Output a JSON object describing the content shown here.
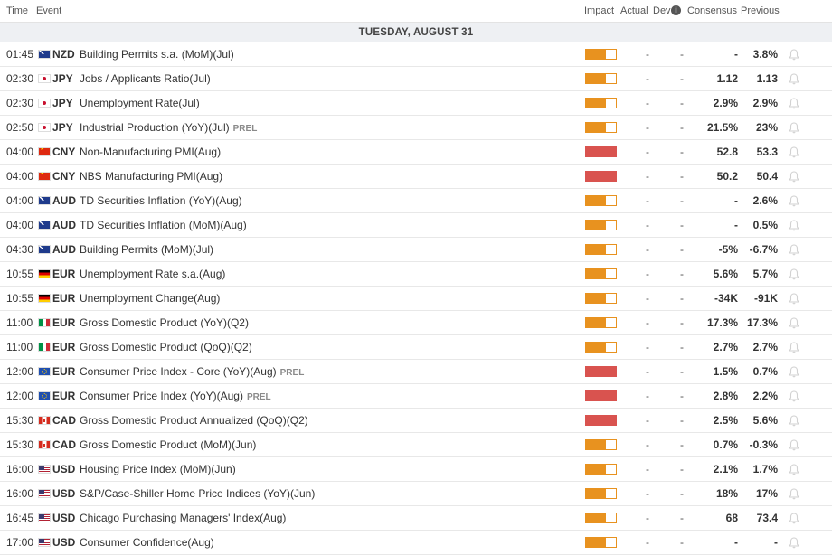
{
  "header": {
    "time": "Time",
    "event": "Event",
    "impact": "Impact",
    "actual": "Actual",
    "dev": "Dev",
    "consensus": "Consensus",
    "previous": "Previous"
  },
  "day_label": "TUESDAY, AUGUST 31",
  "rows": [
    {
      "time": "01:45",
      "currency": "NZD",
      "flag": "nz-flag-icon",
      "event": "Building Permits s.a. (MoM)(Jul)",
      "tag": "",
      "impact": "medium",
      "actual": "-",
      "dev": "-",
      "consensus": "-",
      "previous": "3.8%"
    },
    {
      "time": "02:30",
      "currency": "JPY",
      "flag": "jp-flag-icon",
      "event": "Jobs / Applicants Ratio(Jul)",
      "tag": "",
      "impact": "medium",
      "actual": "-",
      "dev": "-",
      "consensus": "1.12",
      "previous": "1.13"
    },
    {
      "time": "02:30",
      "currency": "JPY",
      "flag": "jp-flag-icon",
      "event": "Unemployment Rate(Jul)",
      "tag": "",
      "impact": "medium",
      "actual": "-",
      "dev": "-",
      "consensus": "2.9%",
      "previous": "2.9%"
    },
    {
      "time": "02:50",
      "currency": "JPY",
      "flag": "jp-flag-icon",
      "event": "Industrial Production (YoY)(Jul)",
      "tag": "PREL",
      "impact": "medium",
      "actual": "-",
      "dev": "-",
      "consensus": "21.5%",
      "previous": "23%"
    },
    {
      "time": "04:00",
      "currency": "CNY",
      "flag": "cn-flag-icon",
      "event": "Non-Manufacturing PMI(Aug)",
      "tag": "",
      "impact": "high",
      "actual": "-",
      "dev": "-",
      "consensus": "52.8",
      "previous": "53.3"
    },
    {
      "time": "04:00",
      "currency": "CNY",
      "flag": "cn-flag-icon",
      "event": "NBS Manufacturing PMI(Aug)",
      "tag": "",
      "impact": "high",
      "actual": "-",
      "dev": "-",
      "consensus": "50.2",
      "previous": "50.4"
    },
    {
      "time": "04:00",
      "currency": "AUD",
      "flag": "au-flag-icon",
      "event": "TD Securities Inflation (YoY)(Aug)",
      "tag": "",
      "impact": "medium",
      "actual": "-",
      "dev": "-",
      "consensus": "-",
      "previous": "2.6%"
    },
    {
      "time": "04:00",
      "currency": "AUD",
      "flag": "au-flag-icon",
      "event": "TD Securities Inflation (MoM)(Aug)",
      "tag": "",
      "impact": "medium",
      "actual": "-",
      "dev": "-",
      "consensus": "-",
      "previous": "0.5%"
    },
    {
      "time": "04:30",
      "currency": "AUD",
      "flag": "au-flag-icon",
      "event": "Building Permits (MoM)(Jul)",
      "tag": "",
      "impact": "medium",
      "actual": "-",
      "dev": "-",
      "consensus": "-5%",
      "previous": "-6.7%"
    },
    {
      "time": "10:55",
      "currency": "EUR",
      "flag": "de-flag-icon",
      "event": "Unemployment Rate s.a.(Aug)",
      "tag": "",
      "impact": "medium",
      "actual": "-",
      "dev": "-",
      "consensus": "5.6%",
      "previous": "5.7%"
    },
    {
      "time": "10:55",
      "currency": "EUR",
      "flag": "de-flag-icon",
      "event": "Unemployment Change(Aug)",
      "tag": "",
      "impact": "medium",
      "actual": "-",
      "dev": "-",
      "consensus": "-34K",
      "previous": "-91K"
    },
    {
      "time": "11:00",
      "currency": "EUR",
      "flag": "it-flag-icon",
      "event": "Gross Domestic Product (YoY)(Q2)",
      "tag": "",
      "impact": "medium",
      "actual": "-",
      "dev": "-",
      "consensus": "17.3%",
      "previous": "17.3%"
    },
    {
      "time": "11:00",
      "currency": "EUR",
      "flag": "it-flag-icon",
      "event": "Gross Domestic Product (QoQ)(Q2)",
      "tag": "",
      "impact": "medium",
      "actual": "-",
      "dev": "-",
      "consensus": "2.7%",
      "previous": "2.7%"
    },
    {
      "time": "12:00",
      "currency": "EUR",
      "flag": "eu-flag-icon",
      "event": "Consumer Price Index - Core (YoY)(Aug)",
      "tag": "PREL",
      "impact": "high",
      "actual": "-",
      "dev": "-",
      "consensus": "1.5%",
      "previous": "0.7%"
    },
    {
      "time": "12:00",
      "currency": "EUR",
      "flag": "eu-flag-icon",
      "event": "Consumer Price Index (YoY)(Aug)",
      "tag": "PREL",
      "impact": "high",
      "actual": "-",
      "dev": "-",
      "consensus": "2.8%",
      "previous": "2.2%"
    },
    {
      "time": "15:30",
      "currency": "CAD",
      "flag": "ca-flag-icon",
      "event": "Gross Domestic Product Annualized (QoQ)(Q2)",
      "tag": "",
      "impact": "high",
      "actual": "-",
      "dev": "-",
      "consensus": "2.5%",
      "previous": "5.6%"
    },
    {
      "time": "15:30",
      "currency": "CAD",
      "flag": "ca-flag-icon",
      "event": "Gross Domestic Product (MoM)(Jun)",
      "tag": "",
      "impact": "medium",
      "actual": "-",
      "dev": "-",
      "consensus": "0.7%",
      "previous": "-0.3%"
    },
    {
      "time": "16:00",
      "currency": "USD",
      "flag": "us-flag-icon",
      "event": "Housing Price Index (MoM)(Jun)",
      "tag": "",
      "impact": "medium",
      "actual": "-",
      "dev": "-",
      "consensus": "2.1%",
      "previous": "1.7%"
    },
    {
      "time": "16:00",
      "currency": "USD",
      "flag": "us-flag-icon",
      "event": "S&P/Case-Shiller Home Price Indices (YoY)(Jun)",
      "tag": "",
      "impact": "medium",
      "actual": "-",
      "dev": "-",
      "consensus": "18%",
      "previous": "17%"
    },
    {
      "time": "16:45",
      "currency": "USD",
      "flag": "us-flag-icon",
      "event": "Chicago Purchasing Managers' Index(Aug)",
      "tag": "",
      "impact": "medium",
      "actual": "-",
      "dev": "-",
      "consensus": "68",
      "previous": "73.4"
    },
    {
      "time": "17:00",
      "currency": "USD",
      "flag": "us-flag-icon",
      "event": "Consumer Confidence(Aug)",
      "tag": "",
      "impact": "medium",
      "actual": "-",
      "dev": "-",
      "consensus": "-",
      "previous": "-"
    }
  ],
  "colors": {
    "impact_medium": "#e8921f",
    "impact_high": "#d9534f",
    "bell": "#d7d7d7"
  },
  "icons": {
    "dev_info": "info-icon",
    "alert": "bell-icon"
  }
}
